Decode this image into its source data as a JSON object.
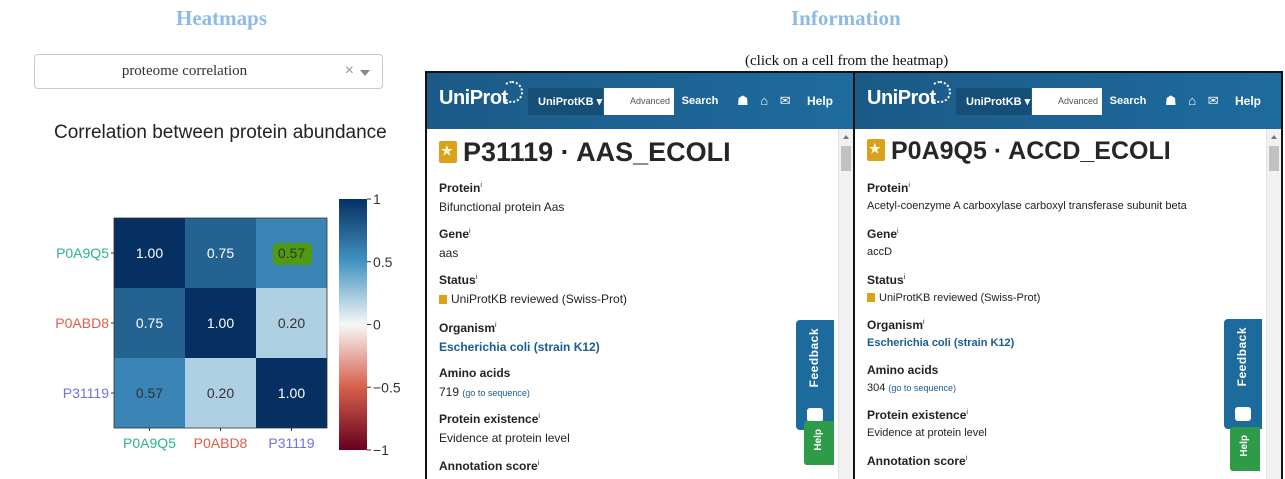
{
  "left_title": "Heatmaps",
  "right_title": "Information",
  "dropdown": {
    "value": "proteome correlation",
    "clear": "×"
  },
  "plot_title": "Correlation between protein abundance",
  "hint": "(click on a cell from the heatmap)",
  "chart_data": {
    "type": "heatmap",
    "title": "Correlation between protein abundance",
    "x_labels": [
      "P0A9Q5",
      "P0ABD8",
      "P31119"
    ],
    "y_labels": [
      "P0A9Q5",
      "P0ABD8",
      "P31119"
    ],
    "label_colors": [
      "#2bb585",
      "#e05c4b",
      "#6b73e6"
    ],
    "values": [
      [
        1.0,
        0.75,
        0.57
      ],
      [
        0.75,
        1.0,
        0.2
      ],
      [
        0.57,
        0.2,
        1.0
      ]
    ],
    "cell_text": [
      [
        "1.00",
        "0.75",
        "0.57"
      ],
      [
        "0.75",
        "1.00",
        "0.20"
      ],
      [
        "0.57",
        "0.20",
        "1.00"
      ]
    ],
    "selected_cell": [
      0,
      2
    ],
    "selected_color": "#4f9a0f",
    "colorbar": {
      "min": -1,
      "max": 1,
      "ticks": [
        "1",
        "0.5",
        "0",
        "−0.5",
        "−1"
      ],
      "tick_values": [
        1,
        0.5,
        0,
        -0.5,
        -1
      ]
    },
    "colorscale": "RdBu"
  },
  "uniprot": {
    "logo": "UniProt",
    "db": "UniProtKB",
    "advanced": "Advanced",
    "search": "Search",
    "icons": "☗ ⌂ ✉",
    "help": "Help",
    "feedback": "Feedback",
    "help_tab": "Help"
  },
  "entries": [
    {
      "accession_title": "P31119 · AAS_ECOLI",
      "protein_label": "Protein",
      "protein": "Bifunctional protein Aas",
      "gene_label": "Gene",
      "gene": "aas",
      "status_label": "Status",
      "status": "UniProtKB reviewed (Swiss-Prot)",
      "organism_label": "Organism",
      "organism": "Escherichia coli (strain K12)",
      "amino_label": "Amino acids",
      "amino": "719",
      "amino_link": "(go to sequence)",
      "existence_label": "Protein existence",
      "existence": "Evidence at protein level",
      "score_label": "Annotation score"
    },
    {
      "accession_title": "P0A9Q5 · ACCD_ECOLI",
      "protein_label": "Protein",
      "protein": "Acetyl-coenzyme A carboxylase carboxyl transferase subunit beta",
      "gene_label": "Gene",
      "gene": "accD",
      "status_label": "Status",
      "status": "UniProtKB reviewed (Swiss-Prot)",
      "organism_label": "Organism",
      "organism": "Escherichia coli (strain K12)",
      "amino_label": "Amino acids",
      "amino": "304",
      "amino_link": "(go to sequence)",
      "existence_label": "Protein existence",
      "existence": "Evidence at protein level",
      "score_label": "Annotation score"
    }
  ]
}
